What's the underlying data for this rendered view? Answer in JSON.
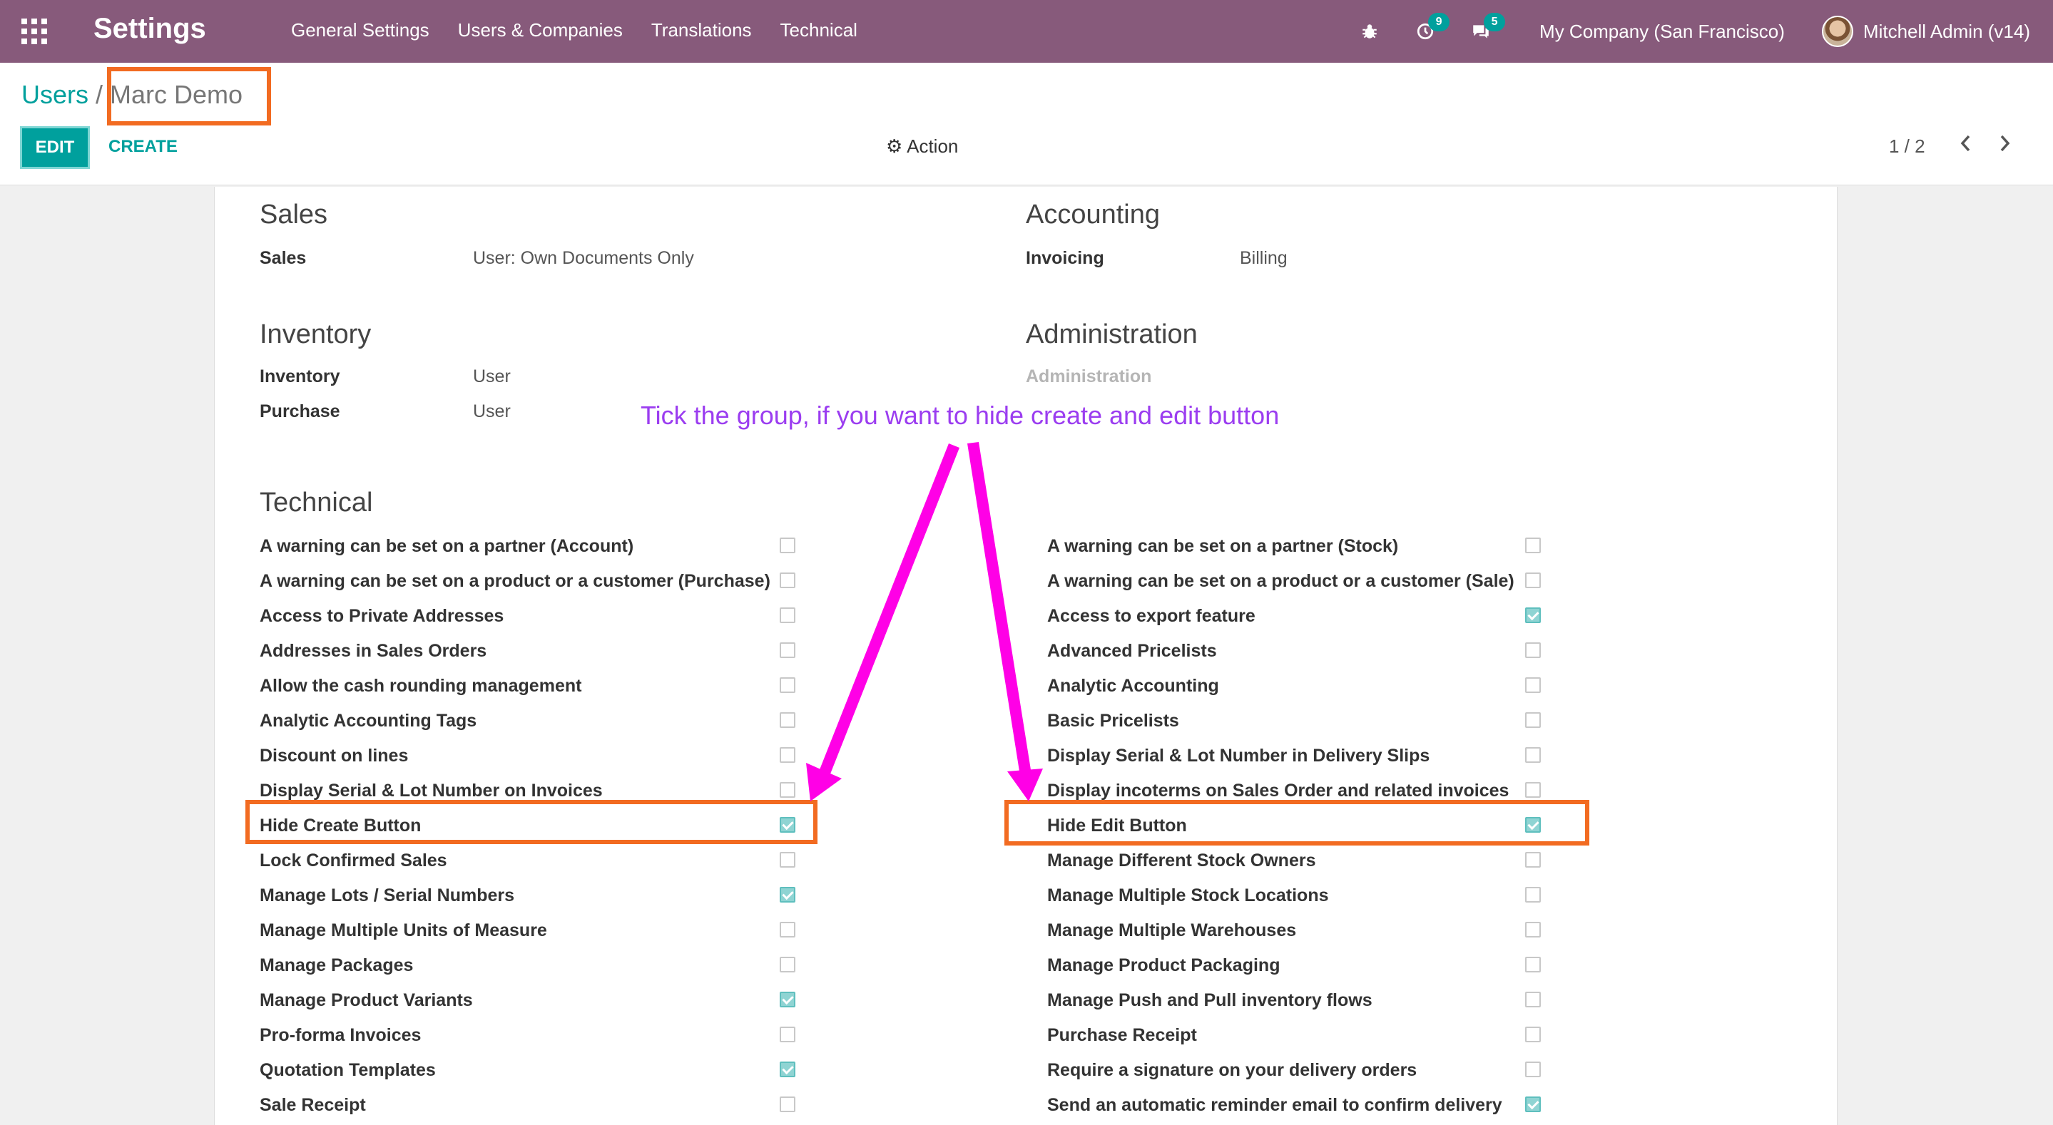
{
  "navbar": {
    "app_title": "Settings",
    "menu": [
      "General Settings",
      "Users & Companies",
      "Translations",
      "Technical"
    ],
    "activity_count": "9",
    "messages_count": "5",
    "company": "My Company (San Francisco)",
    "user": "Mitchell Admin (v14)"
  },
  "control": {
    "breadcrumb_parent": "Users",
    "breadcrumb_sep": "/",
    "breadcrumb_current": "Marc Demo",
    "edit_label": "EDIT",
    "create_label": "CREATE",
    "action_label": "Action",
    "pager": "1 / 2"
  },
  "sections": {
    "sales": {
      "title": "Sales",
      "label": "Sales",
      "value": "User: Own Documents Only"
    },
    "accounting": {
      "title": "Accounting",
      "label": "Invoicing",
      "value": "Billing"
    },
    "inventory": {
      "title": "Inventory",
      "rows": [
        {
          "label": "Inventory",
          "value": "User"
        },
        {
          "label": "Purchase",
          "value": "User"
        }
      ]
    },
    "administration": {
      "title": "Administration",
      "label": "Administration"
    },
    "technical": {
      "title": "Technical"
    }
  },
  "annotation": "Tick the group, if you want to hide create and edit button",
  "technical_left": [
    {
      "label": "A warning can be set on a partner (Account)",
      "checked": false
    },
    {
      "label": "A warning can be set on a product or a customer (Purchase)",
      "checked": false
    },
    {
      "label": "Access to Private Addresses",
      "checked": false
    },
    {
      "label": "Addresses in Sales Orders",
      "checked": false
    },
    {
      "label": "Allow the cash rounding management",
      "checked": false
    },
    {
      "label": "Analytic Accounting Tags",
      "checked": false
    },
    {
      "label": "Discount on lines",
      "checked": false
    },
    {
      "label": "Display Serial & Lot Number on Invoices",
      "checked": false
    },
    {
      "label": "Hide Create Button",
      "checked": true
    },
    {
      "label": "Lock Confirmed Sales",
      "checked": false
    },
    {
      "label": "Manage Lots / Serial Numbers",
      "checked": true
    },
    {
      "label": "Manage Multiple Units of Measure",
      "checked": false
    },
    {
      "label": "Manage Packages",
      "checked": false
    },
    {
      "label": "Manage Product Variants",
      "checked": true
    },
    {
      "label": "Pro-forma Invoices",
      "checked": false
    },
    {
      "label": "Quotation Templates",
      "checked": true
    },
    {
      "label": "Sale Receipt",
      "checked": false
    }
  ],
  "technical_right": [
    {
      "label": "A warning can be set on a partner (Stock)",
      "checked": false
    },
    {
      "label": "A warning can be set on a product or a customer (Sale)",
      "checked": false
    },
    {
      "label": "Access to export feature",
      "checked": true
    },
    {
      "label": "Advanced Pricelists",
      "checked": false
    },
    {
      "label": "Analytic Accounting",
      "checked": false
    },
    {
      "label": "Basic Pricelists",
      "checked": false
    },
    {
      "label": "Display Serial & Lot Number in Delivery Slips",
      "checked": false
    },
    {
      "label": "Display incoterms on Sales Order and related invoices",
      "checked": false
    },
    {
      "label": "Hide Edit Button",
      "checked": true
    },
    {
      "label": "Manage Different Stock Owners",
      "checked": false
    },
    {
      "label": "Manage Multiple Stock Locations",
      "checked": false
    },
    {
      "label": "Manage Multiple Warehouses",
      "checked": false
    },
    {
      "label": "Manage Product Packaging",
      "checked": false
    },
    {
      "label": "Manage Push and Pull inventory flows",
      "checked": false
    },
    {
      "label": "Purchase Receipt",
      "checked": false
    },
    {
      "label": "Require a signature on your delivery orders",
      "checked": false
    },
    {
      "label": "Send an automatic reminder email to confirm delivery",
      "checked": true
    }
  ],
  "colors": {
    "brand": "#875a7b",
    "accent": "#00a09d",
    "highlight": "#f26b21",
    "arrow": "#ff00e6",
    "annotation": "#9b3df0"
  }
}
